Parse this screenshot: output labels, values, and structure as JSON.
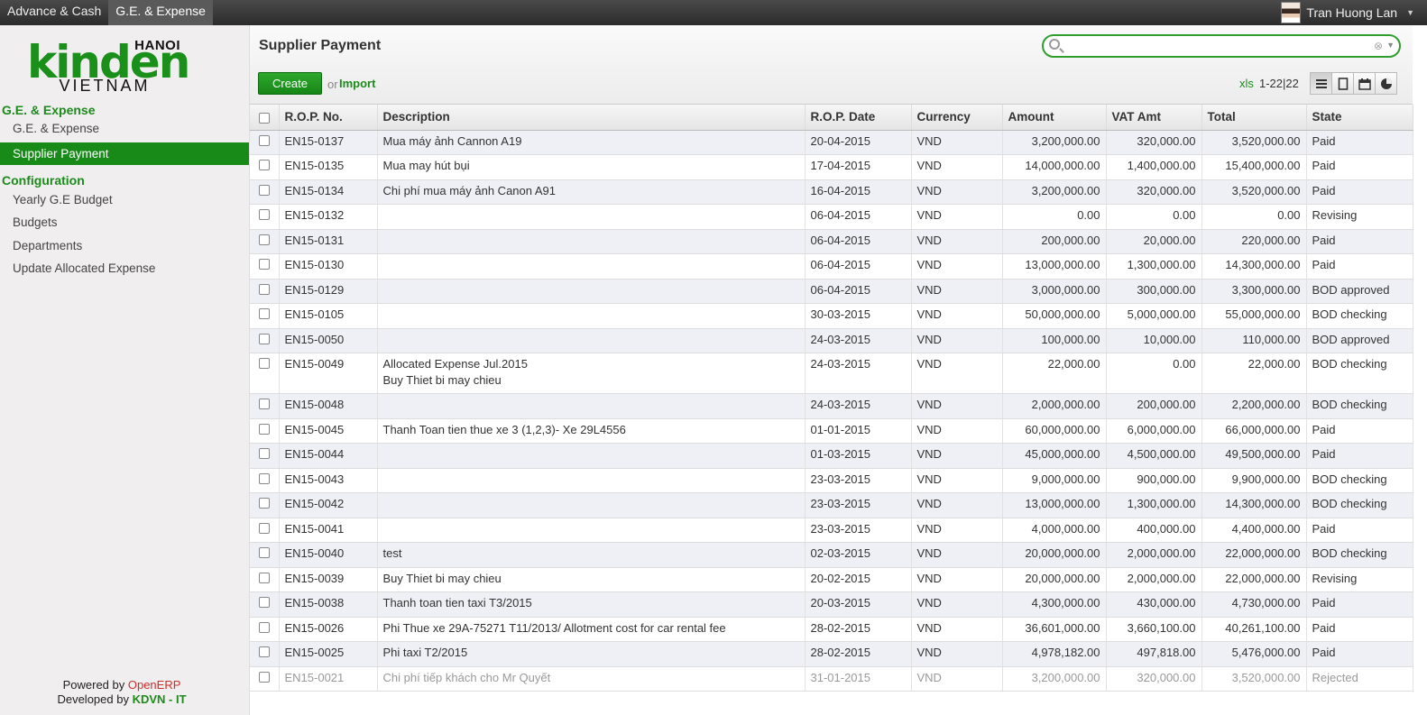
{
  "topbar": {
    "menu": [
      "Advance & Cash",
      "G.E. & Expense"
    ],
    "user": "Tran Huong Lan"
  },
  "logo": {
    "top": "HANOI",
    "main": "kinden",
    "bottom": "VIETNAM"
  },
  "sidebar": {
    "section1": "G.E. & Expense",
    "items1": [
      "G.E. & Expense",
      "Supplier Payment"
    ],
    "section2": "Configuration",
    "items2": [
      "Yearly G.E Budget",
      "Budgets",
      "Departments",
      "Update Allocated Expense"
    ],
    "powered_prefix": "Powered by ",
    "powered_name": "OpenERP",
    "developed_prefix": "Developed by ",
    "developed_name": "KDVN - IT"
  },
  "header": {
    "title": "Supplier Payment",
    "create": "Create",
    "or": "or",
    "import": "Import",
    "xls": "xls",
    "pager": "1-22|22"
  },
  "table": {
    "columns": [
      "R.O.P. No.",
      "Description",
      "R.O.P. Date",
      "Currency",
      "Amount",
      "VAT Amt",
      "Total",
      "State"
    ],
    "rows": [
      [
        "EN15-0137",
        "Mua máy ảnh Cannon A19",
        "20-04-2015",
        "VND",
        "3,200,000.00",
        "320,000.00",
        "3,520,000.00",
        "Paid"
      ],
      [
        "EN15-0135",
        "Mua may hút bụi",
        "17-04-2015",
        "VND",
        "14,000,000.00",
        "1,400,000.00",
        "15,400,000.00",
        "Paid"
      ],
      [
        "EN15-0134",
        "Chi phí mua máy ảnh Canon A91",
        "16-04-2015",
        "VND",
        "3,200,000.00",
        "320,000.00",
        "3,520,000.00",
        "Paid"
      ],
      [
        "EN15-0132",
        "",
        "06-04-2015",
        "VND",
        "0.00",
        "0.00",
        "0.00",
        "Revising"
      ],
      [
        "EN15-0131",
        "",
        "06-04-2015",
        "VND",
        "200,000.00",
        "20,000.00",
        "220,000.00",
        "Paid"
      ],
      [
        "EN15-0130",
        "",
        "06-04-2015",
        "VND",
        "13,000,000.00",
        "1,300,000.00",
        "14,300,000.00",
        "Paid"
      ],
      [
        "EN15-0129",
        "",
        "06-04-2015",
        "VND",
        "3,000,000.00",
        "300,000.00",
        "3,300,000.00",
        "BOD approved"
      ],
      [
        "EN15-0105",
        "",
        "30-03-2015",
        "VND",
        "50,000,000.00",
        "5,000,000.00",
        "55,000,000.00",
        "BOD checking"
      ],
      [
        "EN15-0050",
        "",
        "24-03-2015",
        "VND",
        "100,000.00",
        "10,000.00",
        "110,000.00",
        "BOD approved"
      ],
      [
        "EN15-0049",
        "Allocated Expense Jul.2015\nBuy Thiet bi may chieu",
        "24-03-2015",
        "VND",
        "22,000.00",
        "0.00",
        "22,000.00",
        "BOD checking"
      ],
      [
        "EN15-0048",
        "",
        "24-03-2015",
        "VND",
        "2,000,000.00",
        "200,000.00",
        "2,200,000.00",
        "BOD checking"
      ],
      [
        "EN15-0045",
        "Thanh Toan tien thue xe 3 (1,2,3)- Xe 29L4556",
        "01-01-2015",
        "VND",
        "60,000,000.00",
        "6,000,000.00",
        "66,000,000.00",
        "Paid"
      ],
      [
        "EN15-0044",
        "",
        "01-03-2015",
        "VND",
        "45,000,000.00",
        "4,500,000.00",
        "49,500,000.00",
        "Paid"
      ],
      [
        "EN15-0043",
        "",
        "23-03-2015",
        "VND",
        "9,000,000.00",
        "900,000.00",
        "9,900,000.00",
        "BOD checking"
      ],
      [
        "EN15-0042",
        "",
        "23-03-2015",
        "VND",
        "13,000,000.00",
        "1,300,000.00",
        "14,300,000.00",
        "BOD checking"
      ],
      [
        "EN15-0041",
        "",
        "23-03-2015",
        "VND",
        "4,000,000.00",
        "400,000.00",
        "4,400,000.00",
        "Paid"
      ],
      [
        "EN15-0040",
        "test",
        "02-03-2015",
        "VND",
        "20,000,000.00",
        "2,000,000.00",
        "22,000,000.00",
        "BOD checking"
      ],
      [
        "EN15-0039",
        "Buy Thiet bi may chieu",
        "20-02-2015",
        "VND",
        "20,000,000.00",
        "2,000,000.00",
        "22,000,000.00",
        "Revising"
      ],
      [
        "EN15-0038",
        "Thanh toan tien taxi T3/2015",
        "20-03-2015",
        "VND",
        "4,300,000.00",
        "430,000.00",
        "4,730,000.00",
        "Paid"
      ],
      [
        "EN15-0026",
        "Phi Thue xe 29A-75271 T11/2013/ Allotment cost for car rental fee",
        "28-02-2015",
        "VND",
        "36,601,000.00",
        "3,660,100.00",
        "40,261,100.00",
        "Paid"
      ],
      [
        "EN15-0025",
        "Phi taxi T2/2015",
        "28-02-2015",
        "VND",
        "4,978,182.00",
        "497,818.00",
        "5,476,000.00",
        "Paid"
      ],
      [
        "EN15-0021",
        "Chi phí tiếp khách cho Mr Quyết",
        "31-01-2015",
        "VND",
        "3,200,000.00",
        "320,000.00",
        "3,520,000.00",
        "Rejected"
      ]
    ]
  },
  "colors": {
    "accent": "#188a18",
    "topbar": "#333333",
    "rejected": "#999999"
  }
}
